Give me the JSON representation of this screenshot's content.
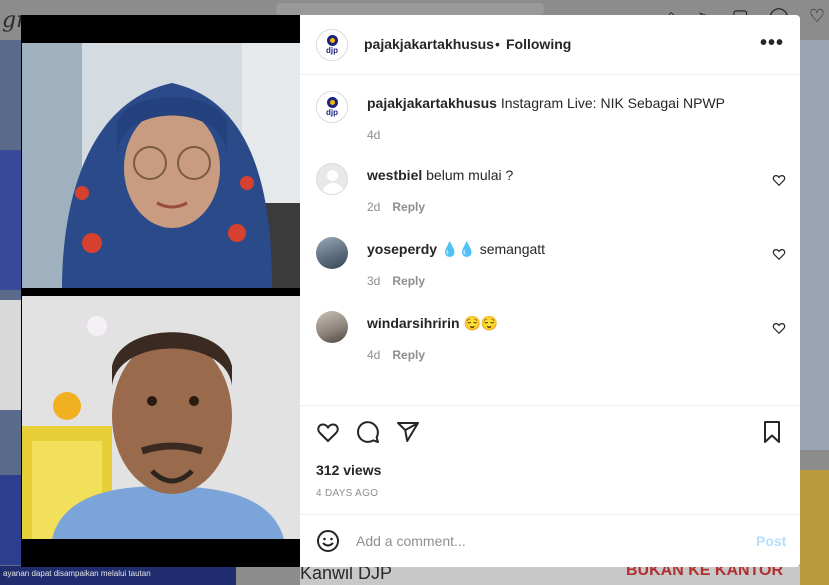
{
  "background": {
    "bottom_caption": "Kanwil DJP",
    "bottom_caption_right": "BUKAN KE KANTOR",
    "bottom_left_text": "ayanan dapat disampaikan melalui tautan",
    "logo_fragment": "gra"
  },
  "header": {
    "username": "pajakjakartakhusus",
    "separator": "•",
    "follow_label": "Following",
    "more_label": "•••",
    "avatar_text": "djp"
  },
  "caption": {
    "username": "pajakjakartakhusus",
    "text": "Instagram Live: NIK Sebagai NPWP",
    "time": "4d"
  },
  "comments": [
    {
      "username": "westbiel",
      "text": "belum mulai ?",
      "time": "2d",
      "reply_label": "Reply"
    },
    {
      "username": "yoseperdy",
      "text": "💧💧 semangatt",
      "time": "3d",
      "reply_label": "Reply"
    },
    {
      "username": "windarsihririn",
      "text": "😌😌",
      "time": "4d",
      "reply_label": "Reply"
    }
  ],
  "stats": {
    "views": "312 views",
    "date": "4 DAYS AGO"
  },
  "add_comment": {
    "placeholder": "Add a comment...",
    "post_label": "Post"
  },
  "colors": {
    "text": "#262626",
    "muted": "#8e8e8e",
    "post_disabled": "#b2dffc",
    "divider": "#efefef"
  }
}
